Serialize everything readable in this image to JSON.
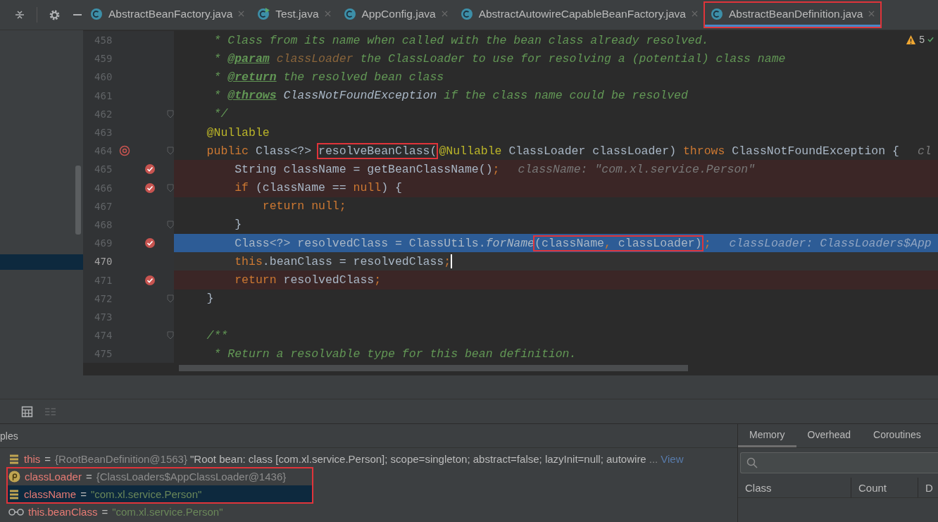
{
  "tabs": [
    {
      "kind": "class",
      "label": "AbstractBeanFactory.java",
      "selected": false,
      "boxed": false
    },
    {
      "kind": "runnable",
      "label": "Test.java",
      "selected": false,
      "boxed": false
    },
    {
      "kind": "class",
      "label": "AppConfig.java",
      "selected": false,
      "boxed": false
    },
    {
      "kind": "class",
      "label": "AbstractAutowireCapableBeanFactory.java",
      "selected": false,
      "boxed": false
    },
    {
      "kind": "class",
      "label": "AbstractBeanDefinition.java",
      "selected": true,
      "boxed": true
    }
  ],
  "inspections": {
    "warnings": "5"
  },
  "editor": {
    "lines": [
      {
        "number": "458",
        "breakpoint": false,
        "method_marker": false,
        "fold": false,
        "execution_point": false,
        "current": false,
        "caret": false,
        "tokens": [
          {
            "kind": "comment",
            "text": "     * Class from its name when called with the bean class already resolved."
          }
        ]
      },
      {
        "number": "459",
        "breakpoint": false,
        "method_marker": false,
        "fold": false,
        "execution_point": false,
        "current": false,
        "caret": false,
        "tokens": [
          {
            "kind": "comment",
            "text": "     * "
          },
          {
            "kind": "doctag",
            "text": "@param"
          },
          {
            "kind": "docparam",
            "text": " classLoader"
          },
          {
            "kind": "comment",
            "text": " the ClassLoader to use for resolving a (potential) class name"
          }
        ]
      },
      {
        "number": "460",
        "breakpoint": false,
        "method_marker": false,
        "fold": false,
        "execution_point": false,
        "current": false,
        "caret": false,
        "tokens": [
          {
            "kind": "comment",
            "text": "     * "
          },
          {
            "kind": "doctag",
            "text": "@return"
          },
          {
            "kind": "comment",
            "text": " the resolved bean class"
          }
        ]
      },
      {
        "number": "461",
        "breakpoint": false,
        "method_marker": false,
        "fold": false,
        "execution_point": false,
        "current": false,
        "caret": false,
        "tokens": [
          {
            "kind": "comment",
            "text": "     * "
          },
          {
            "kind": "doctag",
            "text": "@throws"
          },
          {
            "kind": "docref",
            "text": " ClassNotFoundException"
          },
          {
            "kind": "comment",
            "text": " if the class name could be resolved"
          }
        ]
      },
      {
        "number": "462",
        "breakpoint": false,
        "method_marker": false,
        "fold": true,
        "execution_point": false,
        "current": false,
        "caret": false,
        "tokens": [
          {
            "kind": "comment",
            "text": "     */"
          }
        ]
      },
      {
        "number": "463",
        "breakpoint": false,
        "method_marker": false,
        "fold": false,
        "execution_point": false,
        "current": false,
        "caret": false,
        "tokens": [
          {
            "kind": "annotation",
            "text": "    @Nullable"
          }
        ]
      },
      {
        "number": "464",
        "breakpoint": false,
        "method_marker": true,
        "fold": true,
        "execution_point": false,
        "current": false,
        "caret": false,
        "tokens": [
          {
            "kind": "keyword",
            "text": "    public"
          },
          {
            "kind": "plain",
            "text": " Class<?> "
          },
          {
            "kind": "box",
            "parts": [
              {
                "kind": "plain",
                "text": "resolveBeanClass("
              }
            ]
          },
          {
            "kind": "annotation",
            "text": "@Nullable"
          },
          {
            "kind": "plain",
            "text": " ClassLoader classLoader) "
          },
          {
            "kind": "keyword",
            "text": "throws"
          },
          {
            "kind": "plain",
            "text": " ClassNotFoundException {"
          },
          {
            "kind": "hint",
            "text": "cl"
          }
        ]
      },
      {
        "number": "465",
        "breakpoint": true,
        "method_marker": false,
        "fold": false,
        "execution_point": false,
        "current": false,
        "caret": false,
        "tokens": [
          {
            "kind": "plain",
            "text": "        String className = getBeanClassName()"
          },
          {
            "kind": "keyword",
            "text": ";"
          },
          {
            "kind": "hint",
            "text": "className: \"com.xl.service.Person\""
          }
        ]
      },
      {
        "number": "466",
        "breakpoint": true,
        "method_marker": false,
        "fold": true,
        "execution_point": false,
        "current": false,
        "caret": false,
        "tokens": [
          {
            "kind": "keyword",
            "text": "        if"
          },
          {
            "kind": "plain",
            "text": " (className == "
          },
          {
            "kind": "keyword",
            "text": "null"
          },
          {
            "kind": "plain",
            "text": ") {"
          }
        ]
      },
      {
        "number": "467",
        "breakpoint": false,
        "method_marker": false,
        "fold": false,
        "execution_point": false,
        "current": false,
        "caret": false,
        "tokens": [
          {
            "kind": "keyword",
            "text": "            return null;"
          }
        ]
      },
      {
        "number": "468",
        "breakpoint": false,
        "method_marker": false,
        "fold": true,
        "execution_point": false,
        "current": false,
        "caret": false,
        "tokens": [
          {
            "kind": "plain",
            "text": "        }"
          }
        ]
      },
      {
        "number": "469",
        "breakpoint": true,
        "method_marker": false,
        "fold": false,
        "execution_point": true,
        "current": false,
        "caret": false,
        "tokens": [
          {
            "kind": "plain",
            "text": "        Class<?> resolvedClass = ClassUtils."
          },
          {
            "kind": "method",
            "text": "forName"
          },
          {
            "kind": "box",
            "parts": [
              {
                "kind": "plain",
                "text": "(className"
              },
              {
                "kind": "keyword",
                "text": ","
              },
              {
                "kind": "plain",
                "text": " classLoader)"
              }
            ]
          },
          {
            "kind": "keyword",
            "text": ";"
          },
          {
            "kind": "hint",
            "text": "classLoader: ClassLoaders$App"
          }
        ]
      },
      {
        "number": "470",
        "breakpoint": false,
        "method_marker": false,
        "fold": false,
        "execution_point": false,
        "current": true,
        "caret": true,
        "tokens": [
          {
            "kind": "keyword",
            "text": "        this"
          },
          {
            "kind": "plain",
            "text": ".beanClass = resolvedClass"
          },
          {
            "kind": "keyword",
            "text": ";"
          }
        ]
      },
      {
        "number": "471",
        "breakpoint": true,
        "method_marker": false,
        "fold": false,
        "execution_point": false,
        "current": false,
        "caret": false,
        "tokens": [
          {
            "kind": "keyword",
            "text": "        return"
          },
          {
            "kind": "plain",
            "text": " resolvedClass"
          },
          {
            "kind": "keyword",
            "text": ";"
          }
        ]
      },
      {
        "number": "472",
        "breakpoint": false,
        "method_marker": false,
        "fold": true,
        "execution_point": false,
        "current": false,
        "caret": false,
        "tokens": [
          {
            "kind": "plain",
            "text": "    }"
          }
        ]
      },
      {
        "number": "473",
        "breakpoint": false,
        "method_marker": false,
        "fold": false,
        "execution_point": false,
        "current": false,
        "caret": false
      },
      {
        "number": "474",
        "breakpoint": false,
        "method_marker": false,
        "fold": true,
        "execution_point": false,
        "current": false,
        "caret": false,
        "tokens": [
          {
            "kind": "comment",
            "text": "    /**"
          }
        ]
      },
      {
        "number": "475",
        "breakpoint": false,
        "method_marker": false,
        "fold": false,
        "execution_point": false,
        "current": false,
        "caret": false,
        "tokens": [
          {
            "kind": "comment",
            "text": "     * Return a resolvable type for this bean definition."
          }
        ]
      }
    ]
  },
  "variables": {
    "header": "ples",
    "groups": [
      {
        "boxed": false,
        "rows": [
          {
            "kind": "field",
            "name": "this",
            "operator": "=",
            "selected": false,
            "value": [
              {
                "kind": "object",
                "text": "{RootBeanDefinition@1563}"
              },
              {
                "kind": "text",
                "text": "\"Root bean: class [com.xl.service.Person]; scope=singleton; abstract=false; lazyInit=null; autowire"
              },
              {
                "kind": "ellipsis",
                "text": "..."
              },
              {
                "kind": "link",
                "text": "View"
              }
            ]
          }
        ]
      },
      {
        "boxed": true,
        "rows": [
          {
            "kind": "parameter",
            "name": "classLoader",
            "operator": "=",
            "selected": false,
            "value": [
              {
                "kind": "object",
                "text": "{ClassLoaders$AppClassLoader@1436}"
              }
            ]
          },
          {
            "kind": "field",
            "name": "className",
            "operator": "=",
            "selected": true,
            "value": [
              {
                "kind": "string",
                "text": "\"com.xl.service.Person\""
              }
            ]
          }
        ]
      },
      {
        "boxed": false,
        "rows": [
          {
            "kind": "watch",
            "name": "this.beanClass",
            "operator": "=",
            "selected": false,
            "value": [
              {
                "kind": "string",
                "text": "\"com.xl.service.Person\""
              }
            ]
          }
        ]
      }
    ]
  },
  "memory": {
    "tabs": [
      {
        "label": "Memory",
        "selected": true
      },
      {
        "label": "Overhead",
        "selected": false
      },
      {
        "label": "Coroutines",
        "selected": false
      }
    ],
    "columns": [
      "Class",
      "Count",
      "D"
    ]
  }
}
